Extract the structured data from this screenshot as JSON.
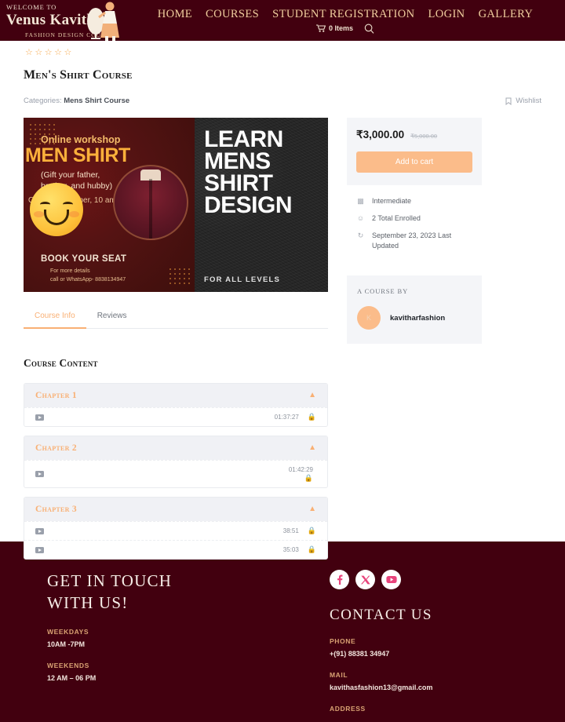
{
  "header": {
    "welcome": "Welcome to",
    "brand": "Venus Kavitha",
    "tagline": "Fashion Design Courses",
    "nav": [
      {
        "label": "Home"
      },
      {
        "label": "Courses"
      },
      {
        "label": "Student Registration"
      },
      {
        "label": "Login"
      },
      {
        "label": "Gallery"
      }
    ],
    "cart_label": "0 Items",
    "cart_icon": "shopping-cart-icon",
    "search_icon": "search-icon"
  },
  "course": {
    "rating_stars": 5,
    "title": "Men's Shirt Course",
    "categories_label": "Categories:",
    "category": "Mens Shirt Course",
    "wishlist_label": "Wishlist",
    "wishlist_icon": "bookmark-icon"
  },
  "banner": {
    "online_workshop": "Online workshop",
    "men_shirt": "MEN SHIRT",
    "gift_line": "(Gift your father, brother, and hubby)",
    "faded_text": "On 5th November, 10 am",
    "book_seat": "BOOK YOUR SEAT",
    "more_details": "For more details\ncall or WhatsApp- 8838134947",
    "headline": "LEARN MENS SHIRT DESIGN",
    "sub": "FOR ALL LEVELS",
    "emoji": "smiling-face-emoji"
  },
  "tabs": [
    {
      "label": "Course Info",
      "active": true
    },
    {
      "label": "Reviews",
      "active": false
    }
  ],
  "content": {
    "section_title": "Course Content",
    "chapters": [
      {
        "title": "Chapter 1",
        "collapse_icon": "chevron-up-icon",
        "lessons": [
          {
            "title": "",
            "duration": "01:37:27",
            "locked": true,
            "wrap": false
          }
        ]
      },
      {
        "title": "Chapter 2",
        "collapse_icon": "chevron-up-icon",
        "lessons": [
          {
            "title": "",
            "duration": "01:42:29",
            "locked": true,
            "wrap": true
          }
        ]
      },
      {
        "title": "Chapter 3",
        "collapse_icon": "chevron-up-icon",
        "lessons": [
          {
            "title": "",
            "duration": "38:51",
            "locked": true,
            "wrap": false
          },
          {
            "title": "",
            "duration": "35:03",
            "locked": true,
            "wrap": false
          }
        ]
      }
    ]
  },
  "sidebar": {
    "price": "₹3,000.00",
    "price_old": "₹5,000.00",
    "add_to_cart": "Add to cart",
    "facts": [
      {
        "icon": "level-bars-icon",
        "text": "Intermediate"
      },
      {
        "icon": "users-enrolled-icon",
        "text": "2 Total Enrolled"
      },
      {
        "icon": "refresh-icon",
        "text": "September 23, 2023 Last Updated"
      }
    ],
    "author_label": "A Course By",
    "author_initial": "K",
    "author_name": "kavitharfashion"
  },
  "footer": {
    "heading": "GET IN TOUCH WITH US!",
    "weekdays_label": "WEEKDAYS",
    "weekdays_value": "10AM -7PM",
    "weekends_label": "WEEKENDS",
    "weekends_value": "12 AM – 06 PM",
    "socials": [
      {
        "name": "facebook-icon",
        "glyph": "f"
      },
      {
        "name": "x-twitter-icon",
        "glyph": "𝕏"
      },
      {
        "name": "youtube-icon",
        "glyph": "▶"
      }
    ],
    "contact_heading": "CONTACT US",
    "phone_label": "PHONE",
    "phone_value": "+(91) 88381 34947",
    "mail_label": "MAIL",
    "mail_value": "kavithasfashion13@gmail.com",
    "address_label": "ADDRESS"
  },
  "colors": {
    "maroon": "#42000f",
    "gold": "#f0cf9e",
    "accent_orange": "#fbbc8a",
    "star": "#f6a74a",
    "card_bg": "#f4f5f8",
    "social_pink": "#e8447c"
  }
}
